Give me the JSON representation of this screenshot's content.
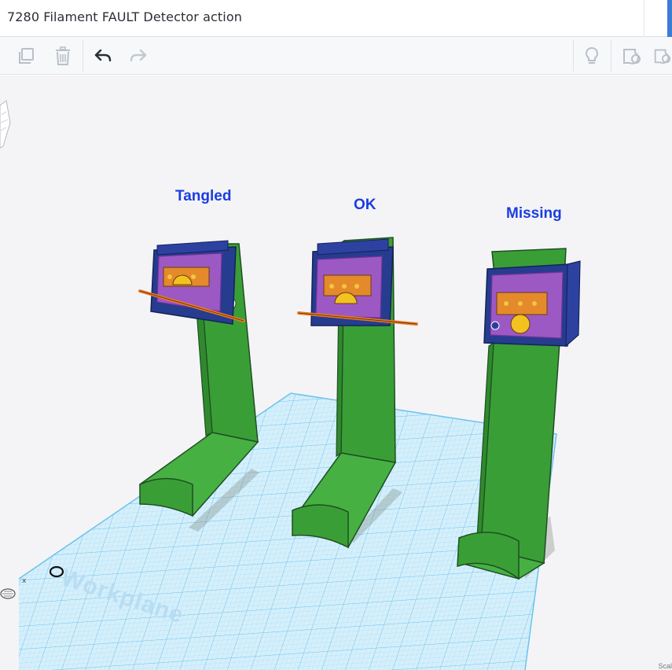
{
  "window": {
    "title": "7280 Filament FAULT Detector action"
  },
  "toolbar": {
    "left_icons": [
      "copy-icon",
      "trash-icon",
      "undo-icon",
      "redo-icon"
    ],
    "right_icons": [
      "lightbulb-icon",
      "shape-icon",
      "shape-icon-2"
    ]
  },
  "scene": {
    "labels": {
      "tangled": "Tangled",
      "ok": "OK",
      "missing": "Missing"
    },
    "workplane": "Workplane",
    "status_fragment": "Scal",
    "colors": {
      "label_blue": "#1a3de0",
      "stand_green": "#3da33a",
      "grid_blue": "#8fd4f3",
      "filament_orange": "#e87a21",
      "sensor_purple": "#c463d6",
      "bracket_navy": "#2b3f9a",
      "switch_orange": "#e48a2a"
    }
  }
}
